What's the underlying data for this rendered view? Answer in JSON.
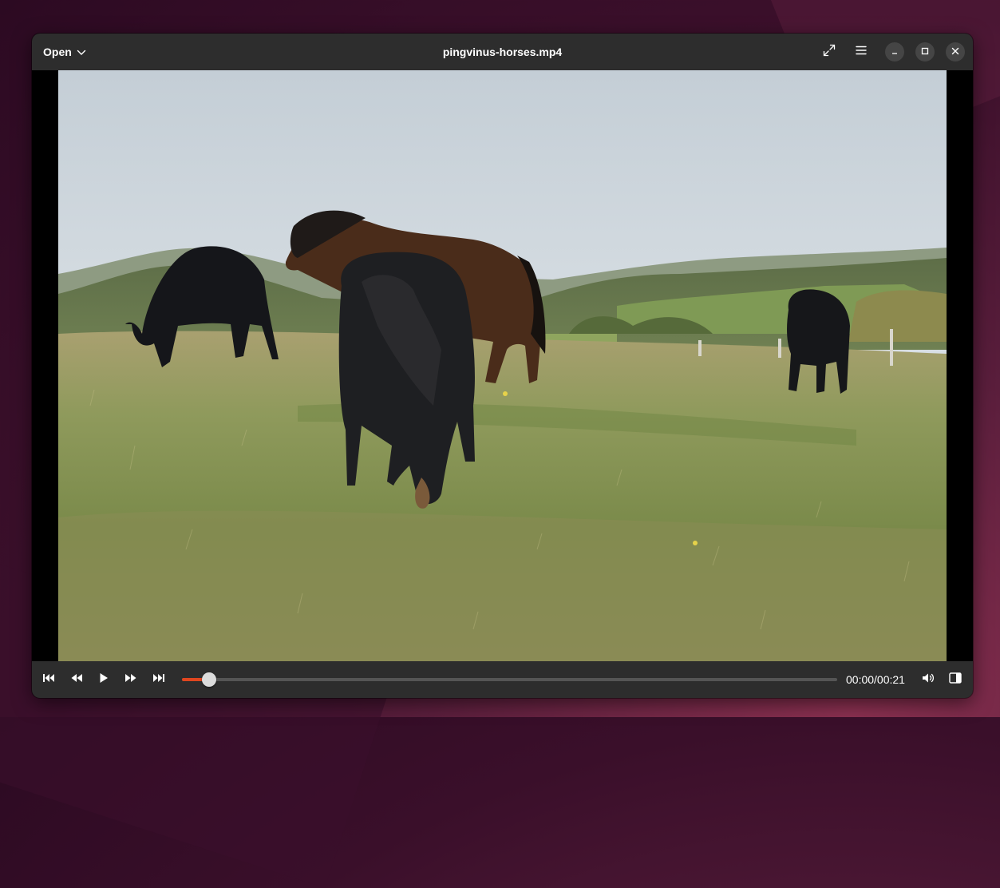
{
  "header": {
    "open_label": "Open",
    "title": "pingvinus-horses.mp4",
    "icons": [
      "chevron-down-icon",
      "fullscreen-icon",
      "hamburger-menu-icon",
      "minimize-icon",
      "maximize-icon",
      "close-icon"
    ]
  },
  "video": {
    "description": "Video frame: four dark horses grazing on a grassy meadow with wooded hills under an overcast sky"
  },
  "controls": {
    "icons": [
      "skip-to-start-icon",
      "rewind-icon",
      "play-icon",
      "fast-forward-icon",
      "skip-to-end-icon",
      "volume-icon",
      "sidebar-toggle-icon"
    ],
    "time": "00:00/00:21",
    "progress_fraction": 0.041
  },
  "colors": {
    "accent": "#e0461f",
    "bar_bg": "#2d2d2d",
    "desktop": "#4a1535"
  }
}
